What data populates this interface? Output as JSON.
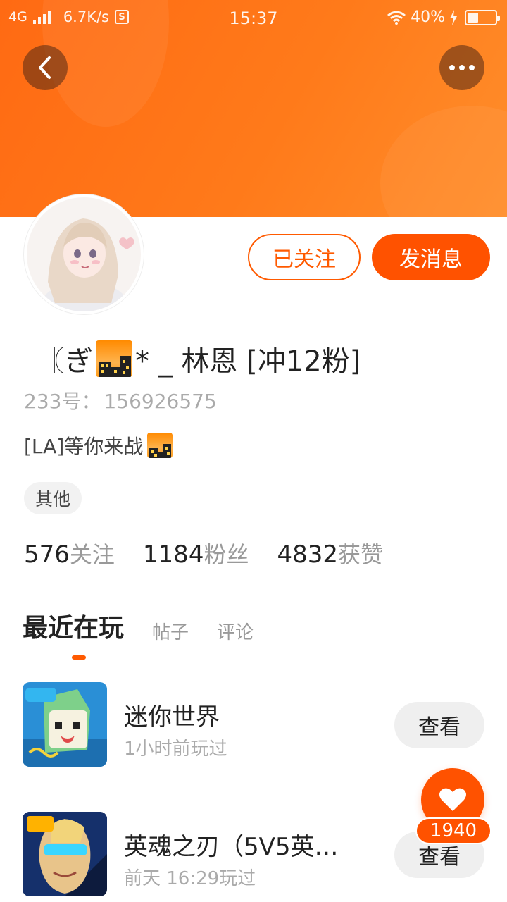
{
  "status_bar": {
    "network": "4G",
    "speed": "6.7K/s",
    "sim_icon": "S",
    "time": "15:37",
    "battery": "40%",
    "battery_level": 0.4
  },
  "header": {
    "back_icon": "chevron-left-icon",
    "more_icon": "more-dots-icon"
  },
  "profile": {
    "follow_label": "已关注",
    "message_label": "发消息",
    "nickname_prefix": "〖ぎ",
    "nickname_suffix": "* _ 林恩 [冲12粉]",
    "id_label": "233号：",
    "id_value": "156926575",
    "bio_text": "[LA]等你来战",
    "tag": "其他"
  },
  "stats": [
    {
      "num": "576",
      "label": "关注"
    },
    {
      "num": "1184",
      "label": "粉丝"
    },
    {
      "num": "4832",
      "label": "获赞"
    }
  ],
  "tabs": [
    "最近在玩",
    "帖子",
    "评论"
  ],
  "games": [
    {
      "title": "迷你世界",
      "sub": "1小时前玩过",
      "button": "查看"
    },
    {
      "title": "英魂之刃（5V5英…",
      "sub": "前天 16:29玩过",
      "button": "查看"
    }
  ],
  "like": {
    "count": "1940"
  },
  "colors": {
    "accent": "#ff5200",
    "banner": "#ff7a1a"
  }
}
